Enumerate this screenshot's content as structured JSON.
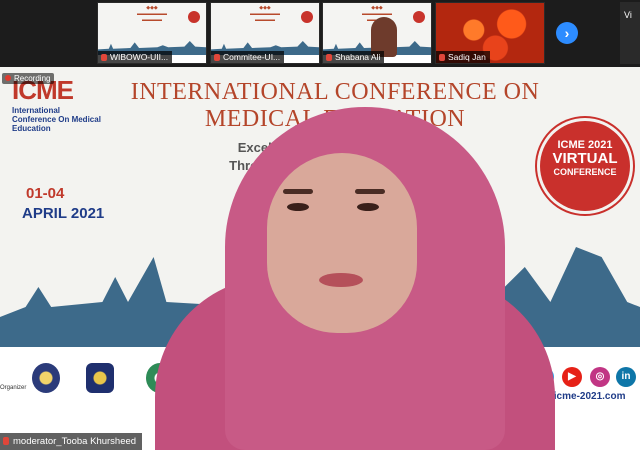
{
  "gallery": {
    "tiles": [
      {
        "label": "WIBOWO-UII..."
      },
      {
        "label": "Commitee-UI..."
      },
      {
        "label": "Shabana Ali"
      },
      {
        "label": "Sadiq Jan"
      }
    ],
    "right_partial": "Vi"
  },
  "recording": {
    "label": "Recording"
  },
  "slide": {
    "logo": {
      "mark": "ICME",
      "subtitle": "International Conference On Medical Education"
    },
    "title": "INTERNATIONAL CONFERENCE ON MEDICAL EDUCATION",
    "subtitle_lines": [
      "Excellence in Medical Education;",
      "Through International Collaboration"
    ],
    "dates": "01-04",
    "month": "APRIL 2021",
    "badge": {
      "line1": "ICME 2021",
      "line2": "VIRTUAL",
      "line3": "CONFERENCE"
    },
    "organizer_label": "Organizer",
    "website": "ite: icme-2021.com",
    "social": [
      {
        "name": "twitter-icon",
        "color": "#1da1f2",
        "glyph": "t"
      },
      {
        "name": "youtube-icon",
        "color": "#e62117",
        "glyph": "▶"
      },
      {
        "name": "instagram-icon",
        "color": "#c13584",
        "glyph": "◎"
      },
      {
        "name": "linkedin-icon",
        "color": "#0e76a8",
        "glyph": "in"
      }
    ]
  },
  "speaker": {
    "name_label": "moderator_Tooba Khursheed"
  },
  "colors": {
    "accent": "#2d8cff",
    "recording": "#e03a2f",
    "title": "#b4452a",
    "navy": "#1f3c88"
  }
}
